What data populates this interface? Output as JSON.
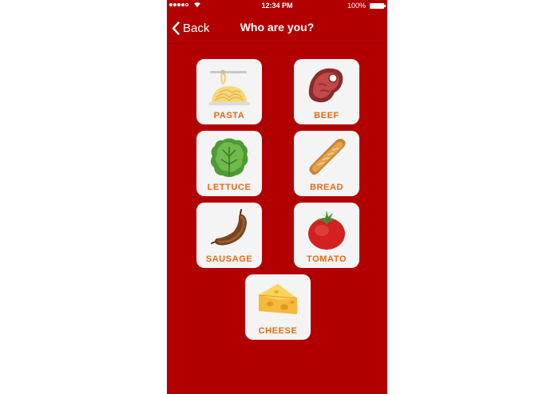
{
  "status_bar": {
    "time": "12:34 PM",
    "battery": "100%",
    "wifi_icon": "wifi-icon",
    "signal_icon": "signal-dots-icon"
  },
  "nav": {
    "back_label": "Back",
    "title": "Who are you?"
  },
  "foods": [
    {
      "label": "PASTA",
      "icon": "pasta-icon"
    },
    {
      "label": "BEEF",
      "icon": "steak-icon"
    },
    {
      "label": "LETTUCE",
      "icon": "lettuce-icon"
    },
    {
      "label": "BREAD",
      "icon": "baguette-icon"
    },
    {
      "label": "SAUSAGE",
      "icon": "sausage-icon"
    },
    {
      "label": "TOMATO",
      "icon": "tomato-icon"
    },
    {
      "label": "CHEESE",
      "icon": "cheese-icon"
    }
  ],
  "colors": {
    "background": "#b20000",
    "tile": "#f4f4f4",
    "label": "#e46a12"
  }
}
